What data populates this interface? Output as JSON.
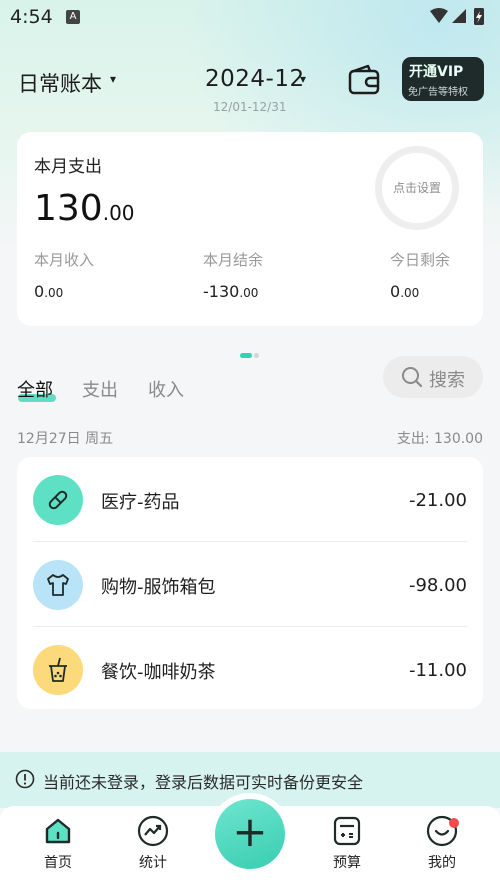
{
  "status_bar": {
    "time": "4:54",
    "notification_glyph": "A"
  },
  "header": {
    "book_title": "日常账本",
    "book_caret": "▾",
    "month": "2024-12",
    "month_caret": "▾",
    "month_range": "12/01-12/31",
    "vip_title": "开通VIP",
    "vip_subtitle": "免广告等特权"
  },
  "summary": {
    "label": "本月支出",
    "amount_int": "130",
    "amount_dec": ".00",
    "budget_text": "点击设置",
    "income_label": "本月收入",
    "income_int": "0",
    "income_dec": ".00",
    "balance_label": "本月结余",
    "balance_int": "-130",
    "balance_dec": ".00",
    "today_label": "今日剩余",
    "today_int": "0",
    "today_dec": ".00"
  },
  "tabs": [
    {
      "label": "全部",
      "active": true
    },
    {
      "label": "支出",
      "active": false
    },
    {
      "label": "收入",
      "active": false
    }
  ],
  "search": {
    "label": "搜索"
  },
  "date_group": {
    "date": "12月27日 周五",
    "total": "支出: 130.00"
  },
  "transactions": [
    {
      "name": "医疗-药品",
      "amount": "-21.00",
      "icon": "pill-icon",
      "color": "#5ee0c4"
    },
    {
      "name": "购物-服饰箱包",
      "amount": "-98.00",
      "icon": "tshirt-icon",
      "color": "#b9e4f7"
    },
    {
      "name": "餐饮-咖啡奶茶",
      "amount": "-11.00",
      "icon": "bubble-tea-icon",
      "color": "#fcd97a"
    }
  ],
  "login_banner": {
    "text": "当前还未登录，登录后数据可实时备份更安全"
  },
  "bottom_nav": [
    {
      "label": "首页",
      "icon": "home-icon"
    },
    {
      "label": "统计",
      "icon": "trend-chart-icon"
    },
    {
      "label": "",
      "icon": "plus-icon",
      "glyph": "+"
    },
    {
      "label": "预算",
      "icon": "calculator-icon"
    },
    {
      "label": "我的",
      "icon": "smiley-profile-icon"
    }
  ],
  "colors": {
    "accent": "#34d1b3",
    "vip_bg": "#1e2b2a",
    "notification_dot": "#f34a4a"
  }
}
